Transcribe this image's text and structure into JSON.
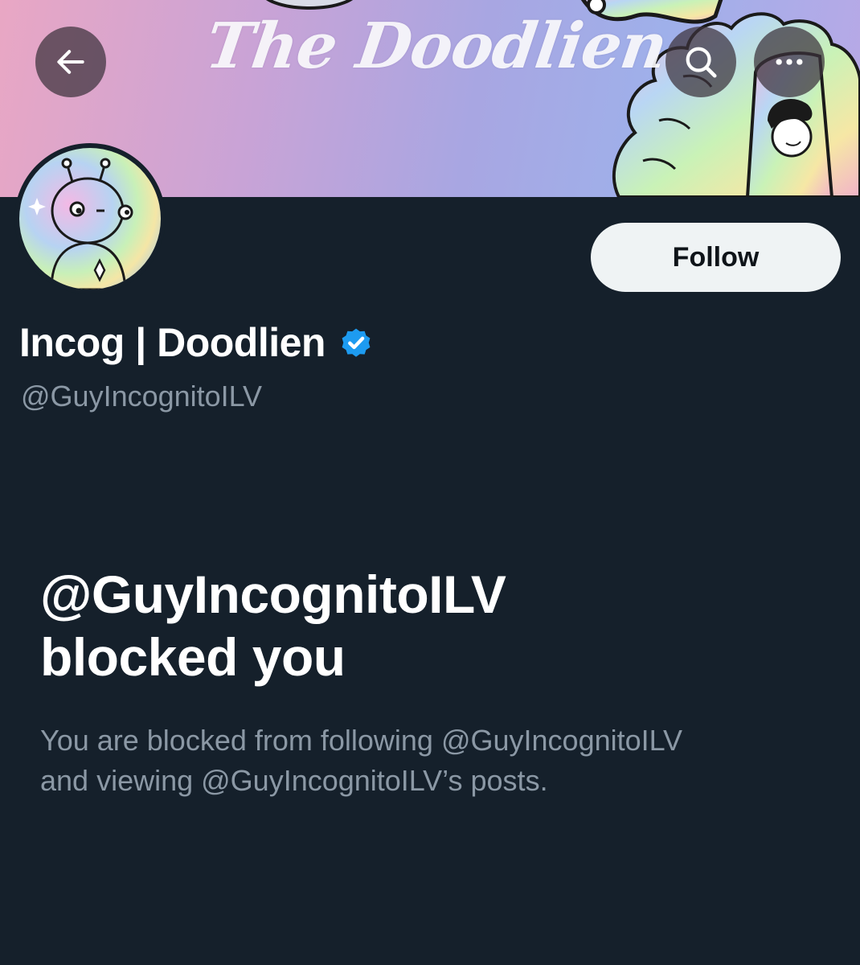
{
  "header": {
    "banner_title": "The Doodlien",
    "back_icon": "arrow-left-icon",
    "search_icon": "search-icon",
    "more_icon": "more-horizontal-icon"
  },
  "profile": {
    "display_name": "Incog | Doodlien",
    "verified_icon": "verified-badge-icon",
    "handle": "@GuyIncognitoILV",
    "follow_label": "Follow"
  },
  "blocked": {
    "title_line1": "@GuyIncognitoILV",
    "title_line2": "blocked you",
    "desc_line1": "You are blocked from following @GuyIncognitoILV",
    "desc_line2": "and viewing @GuyIncognitoILV’s posts."
  },
  "colors": {
    "background": "#15202b",
    "follow_bg": "#eff3f4",
    "secondary_text": "#8b98a5",
    "verified": "#1d9bf0"
  }
}
